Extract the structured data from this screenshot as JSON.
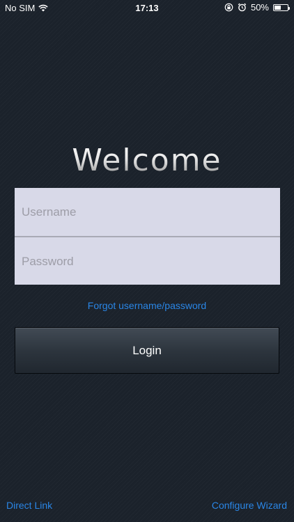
{
  "status_bar": {
    "carrier": "No SIM",
    "time": "17:13",
    "battery_percent": "50%",
    "battery_level": 0.5,
    "icons": [
      "wifi-icon",
      "orientation-lock-icon",
      "alarm-icon",
      "battery-icon"
    ]
  },
  "welcome": {
    "title": "Welcome"
  },
  "form": {
    "username_placeholder": "Username",
    "username_value": "",
    "password_placeholder": "Password",
    "password_value": ""
  },
  "forgot": {
    "label": "Forgot username/password"
  },
  "login": {
    "label": "Login"
  },
  "footer": {
    "direct_link_label": "Direct Link",
    "configure_wizard_label": "Configure Wizard"
  },
  "colors": {
    "background": "#1b222b",
    "link": "#2a86e6",
    "input_background": "#d8d9e8"
  }
}
